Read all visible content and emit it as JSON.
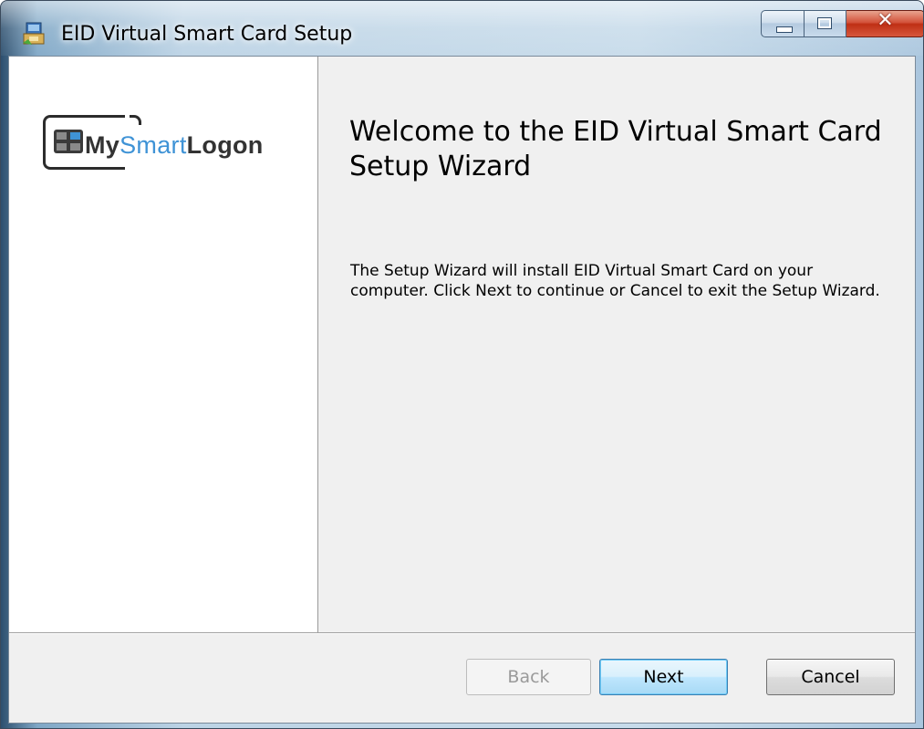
{
  "window": {
    "title": "EID Virtual Smart Card Setup",
    "caption": {
      "minimize": "minimize",
      "maximize": "maximize",
      "close": "✕"
    }
  },
  "logo": {
    "my": "My",
    "smart": "Smart",
    "logon": "Logon"
  },
  "wizard": {
    "heading": "Welcome to the EID Virtual Smart Card Setup Wizard",
    "body": "The Setup Wizard will install EID Virtual Smart Card on your computer. Click Next to continue or Cancel to exit the Setup Wizard."
  },
  "buttons": {
    "back": "Back",
    "next": "Next",
    "cancel": "Cancel"
  },
  "colors": {
    "logo_accent": "#3f93d6",
    "close_button": "#c7371b",
    "dialog_background": "#f0f0f0"
  }
}
